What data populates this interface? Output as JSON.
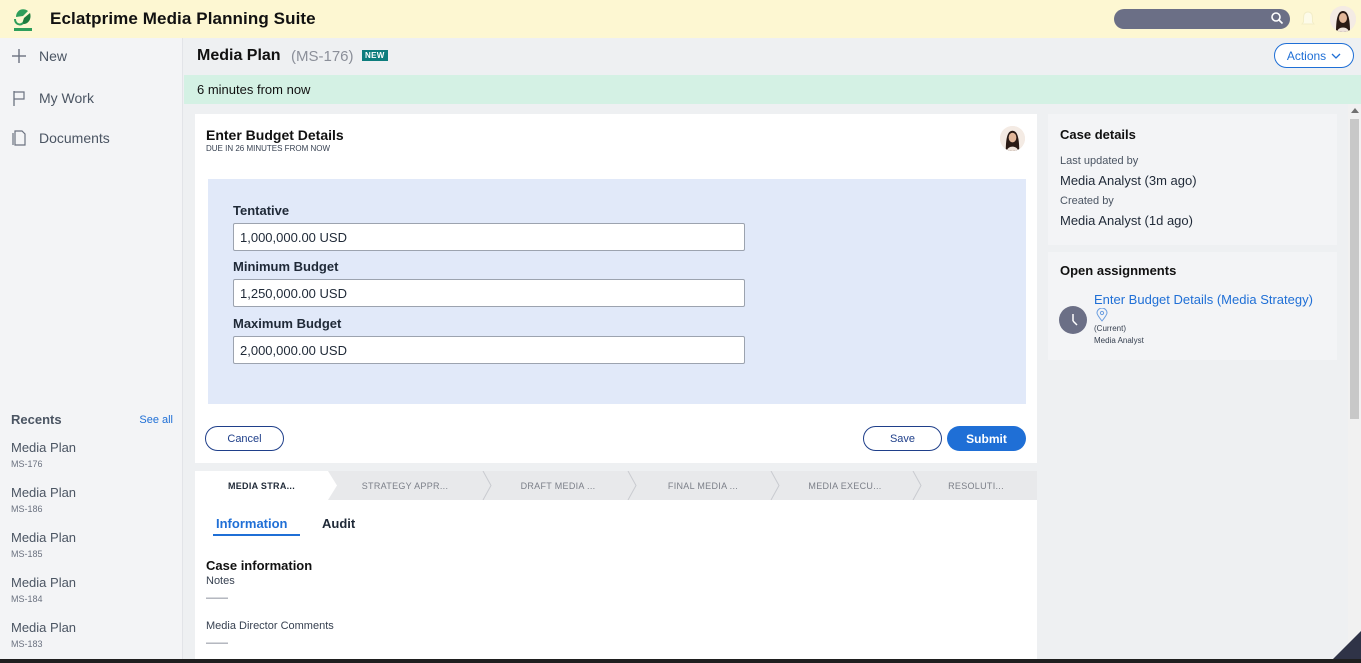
{
  "app": {
    "title": "Eclatprime Media Planning Suite"
  },
  "search": {
    "placeholder": ""
  },
  "sidebar": {
    "items": [
      {
        "label": "New",
        "icon": "plus-icon"
      },
      {
        "label": "My Work",
        "icon": "flag-icon"
      },
      {
        "label": "Documents",
        "icon": "document-icon"
      }
    ],
    "recents_title": "Recents",
    "see_all": "See all",
    "recents": [
      {
        "title": "Media Plan",
        "id": "MS-176"
      },
      {
        "title": "Media Plan",
        "id": "MS-186"
      },
      {
        "title": "Media Plan",
        "id": "MS-185"
      },
      {
        "title": "Media Plan",
        "id": "MS-184"
      },
      {
        "title": "Media Plan",
        "id": "MS-183"
      }
    ]
  },
  "case": {
    "title": "Media Plan",
    "id": "(MS-176)",
    "badge": "NEW",
    "actions_label": "Actions",
    "banner": "6 minutes from now"
  },
  "assignment": {
    "title": "Enter Budget Details",
    "due": "DUE IN 26 MINUTES FROM NOW",
    "fields": [
      {
        "label": "Tentative",
        "value": "1,000,000.00 USD"
      },
      {
        "label": "Minimum Budget",
        "value": "1,250,000.00 USD"
      },
      {
        "label": "Maximum Budget",
        "value": "2,000,000.00 USD"
      }
    ],
    "cancel_label": "Cancel",
    "save_label": "Save",
    "submit_label": "Submit"
  },
  "stages": [
    {
      "label": "MEDIA STRA...",
      "active": true
    },
    {
      "label": "STRATEGY APPR...",
      "active": false
    },
    {
      "label": "DRAFT MEDIA ...",
      "active": false
    },
    {
      "label": "FINAL MEDIA ...",
      "active": false
    },
    {
      "label": "MEDIA EXECU...",
      "active": false
    },
    {
      "label": "RESOLUTI...",
      "active": false
    }
  ],
  "tabs": {
    "information": "Information",
    "audit": "Audit"
  },
  "case_info": {
    "title": "Case information",
    "notes_label": "Notes",
    "notes_value": "——",
    "comments_label": "Media Director Comments",
    "comments_value": "——"
  },
  "case_details": {
    "title": "Case details",
    "last_updated_label": "Last updated by",
    "last_updated_value": "Media Analyst (3m ago)",
    "created_label": "Created by",
    "created_value": "Media Analyst (1d ago)"
  },
  "open_assignments": {
    "title": "Open assignments",
    "link": "Enter Budget Details (Media Strategy)",
    "status": "(Current)",
    "assignee": "Media Analyst"
  },
  "colors": {
    "accent": "#1f6fd6",
    "header_bg": "#fdf7d2",
    "banner_bg": "#d4f1e4",
    "badge": "#0d7d7d"
  }
}
